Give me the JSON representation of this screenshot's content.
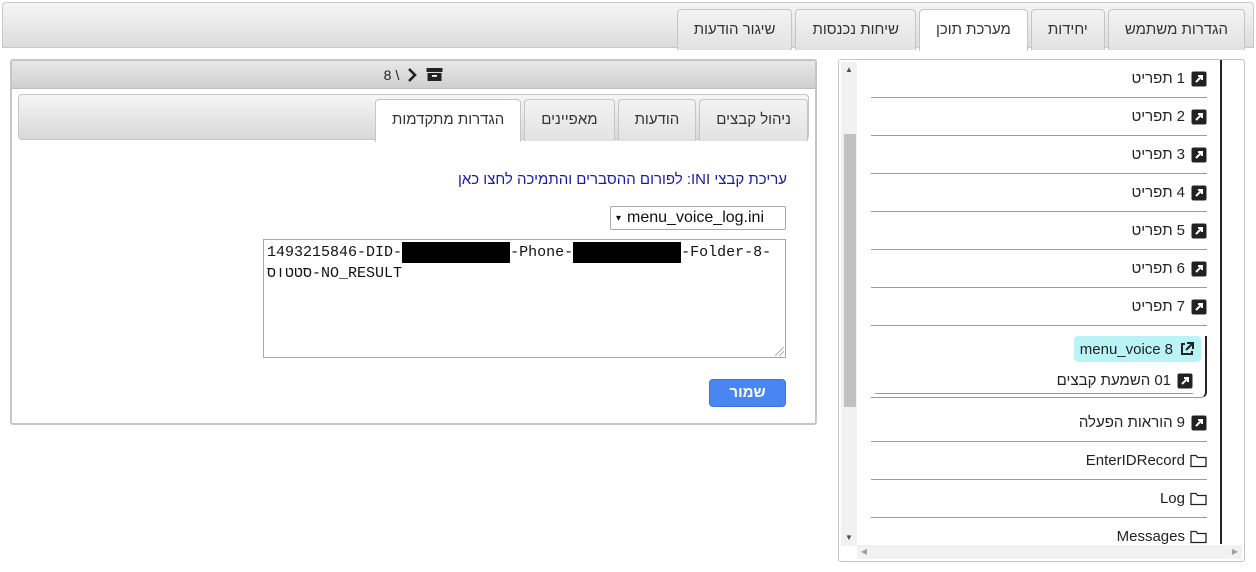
{
  "top_tabs": [
    "הגדרות משתמש",
    "יחידות",
    "מערכת תוכן",
    "שיחות נכנסות",
    "שיגור הודעות"
  ],
  "active_top_tab": "מערכת תוכן",
  "panel_header": {
    "separator": "\\",
    "number": "8",
    "icons": [
      "archive-icon",
      "chevron-right-icon"
    ]
  },
  "inner_tabs": [
    "ניהול קבצים",
    "הודעות",
    "מאפיינים",
    "הגדרות מתקדמות"
  ],
  "active_inner_tab": "הגדרות מתקדמות",
  "ini": {
    "prefix": "עריכת קבצי INI:",
    "link": "לפורום ההסברים והתמיכה לחצו כאן"
  },
  "file_select": {
    "value": "menu_voice_log.ini",
    "caret": "▾"
  },
  "log_text": {
    "part1": "1493215846-DID-",
    "redact1": "XXXXXXXXXXXX",
    "part2": "-Phone-",
    "redact2": "XXXXXXXXXXXX",
    "part3": "-Folder-8-",
    "line2": "סטטוס-NO_RESULT"
  },
  "save_label": "שמור",
  "tree": {
    "items": [
      {
        "num": "1",
        "label": "תפריט",
        "icon": "shortcut-icon"
      },
      {
        "num": "2",
        "label": "תפריט",
        "icon": "shortcut-icon"
      },
      {
        "num": "3",
        "label": "תפריט",
        "icon": "shortcut-icon"
      },
      {
        "num": "4",
        "label": "תפריט",
        "icon": "shortcut-icon"
      },
      {
        "num": "5",
        "label": "תפריט",
        "icon": "shortcut-icon"
      },
      {
        "num": "6",
        "label": "תפריט",
        "icon": "shortcut-icon"
      },
      {
        "num": "7",
        "label": "תפריט",
        "icon": "shortcut-icon"
      }
    ],
    "selected": {
      "num": "8",
      "label": "menu_voice",
      "icon": "external-link-icon"
    },
    "child": {
      "num": "01",
      "label": "השמעת קבצים",
      "icon": "shortcut-icon"
    },
    "after": [
      {
        "num": "9",
        "label": "הוראות הפעלה",
        "icon": "shortcut-icon"
      },
      {
        "num": "",
        "label": "EnterIDRecord",
        "icon": "folder-icon"
      },
      {
        "num": "",
        "label": "Log",
        "icon": "folder-icon"
      },
      {
        "num": "",
        "label": "Messages",
        "icon": "folder-icon"
      }
    ]
  },
  "colors": {
    "accent": "#4a86f3",
    "highlight": "#b9f3f5",
    "link": "#1a1aa6"
  }
}
